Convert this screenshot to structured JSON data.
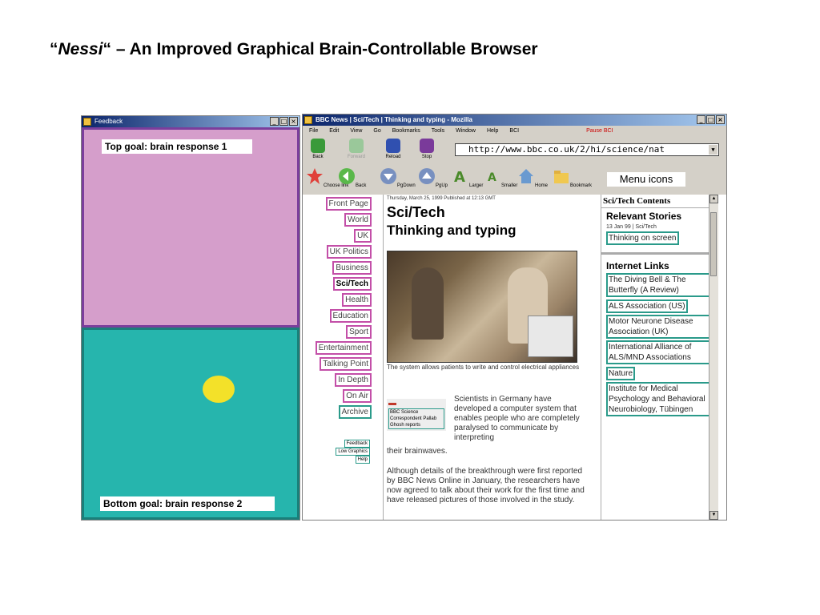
{
  "slide": {
    "title_open_quote": "“",
    "title_italic": "Nessi",
    "title_rest": "“ – An Improved Graphical Brain-Controllable Browser"
  },
  "feedback_window": {
    "title": "Feedback",
    "top_goal": "Top goal: brain response 1",
    "bottom_goal": "Bottom goal: brain response 2",
    "colors": {
      "top": "#d59ecb",
      "bottom": "#26b5ad",
      "ball": "#f3e129"
    }
  },
  "browser": {
    "title": "BBC News | Sci/Tech | Thinking and typing - Mozilla",
    "menu": [
      "File",
      "Edit",
      "View",
      "Go",
      "Bookmarks",
      "Tools",
      "Window",
      "Help",
      "BCI"
    ],
    "status_tag": "Pause BCI",
    "toolbar": [
      "Back",
      "Forward",
      "Reload",
      "Stop"
    ],
    "url": "http://www.bbc.co.uk/2/hi/science/nat",
    "bci_buttons": [
      "Choose link",
      "Back",
      "PgDown",
      "PgUp",
      "Larger",
      "Smaller",
      "Home",
      "Bookmark"
    ],
    "menu_icons_label": "Menu icons",
    "left_nav": [
      "Front Page",
      "World",
      "UK",
      "UK Politics",
      "Business",
      "Sci/Tech",
      "Health",
      "Education",
      "Sport",
      "Entertainment",
      "Talking Point",
      "In Depth",
      "On Air",
      "Archive"
    ],
    "left_nav_small": [
      "Feedback",
      "Low Graphics",
      "Help"
    ],
    "date_line": "Thursday, March 25, 1999 Published at 12:13 GMT",
    "section": "Sci/Tech",
    "headline": "Thinking and typing",
    "caption": "The system allows patients to write and control electrical appliances",
    "side_links": [
      "BBC Science Correspondent Pallab Ghosh reports"
    ],
    "para1": "Scientists in Germany have developed a computer system that enables people who are completely paralysed to communicate by interpreting",
    "para1_end": "their brainwaves.",
    "para2": "Although details of the breakthrough were first reported by BBC News Online in January, the researchers have now agreed to talk about their work for the first time and have released pictures of those involved in the study.",
    "right_header": "Sci/Tech Contents",
    "relevant_title": "Relevant Stories",
    "relevant_date": "13 Jan 99 | Sci/Tech",
    "relevant_links": [
      "Thinking on screen"
    ],
    "internet_title": "Internet Links",
    "internet_links": [
      "The Diving Bell & The Butterfly (A Review)",
      "ALS Association (US)",
      "Motor Neurone Disease Association (UK)",
      "International Alliance of ALS/MND Associations",
      "Nature",
      "Institute for Medical Psychology and Behavioral Neurobiology, Tübingen"
    ]
  }
}
